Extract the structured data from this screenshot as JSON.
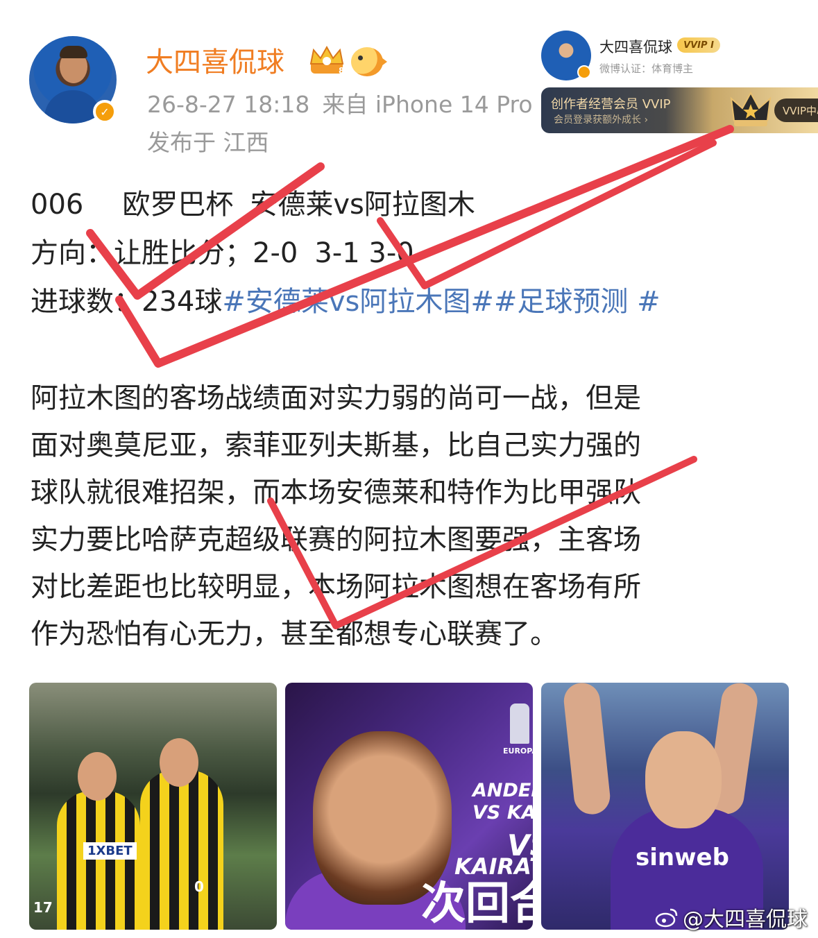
{
  "post": {
    "username": "大四喜侃球",
    "timestamp": "26-8-27 18:18",
    "source": "来自 iPhone 14 Pro",
    "location": "发布于 江西",
    "line1_code": "006",
    "line1_league": "欧罗巴杯",
    "line1_match": "安德莱vs阿拉图木",
    "line2_label": "方向：",
    "line2_value": "让胜比分；2-0",
    "line2_scores": "3-1 3-0",
    "line3_label": "进球数：",
    "line3_value": "234球",
    "line3_tags": "#安德莱vs阿拉木图##足球预测 #",
    "analysis_lines": [
      "阿拉木图的客场战绩面对实力弱的尚可一战，但是",
      "面对奥莫尼亚，索菲亚列夫斯基，比自己实力强的",
      "球队就很难招架，而本场安德莱和特作为比甲强队",
      "实力要比哈萨克超级联赛的阿拉木图要强，主客场",
      "对比差距也比较明显，本场阿拉木图想在客场有所",
      "作为恐怕有心无力，甚至都想专心联赛了。"
    ]
  },
  "profile_card": {
    "name": "大四喜侃球",
    "vip_badge": "VVIP I",
    "auth": "微博认证：体育博主",
    "banner_title": "创作者经营会员 VVIP",
    "banner_sub": "会员登录获额外成长 ›",
    "banner_button": "VVIP中心"
  },
  "images": [
    {
      "name": "kairat-players-celebrating",
      "sponsor": "1XBET",
      "number": "17",
      "number2": "0"
    },
    {
      "name": "anderlecht-vs-kairat-poster",
      "league": "EUROPA LEAGUE",
      "title1": "ANDERL",
      "title2": "VS KAIRAT A",
      "title3": "VS",
      "title4": "KAIRAT A",
      "title5": "次回合"
    },
    {
      "name": "anderlecht-player-applauding",
      "sponsor": "sinweb"
    }
  ],
  "watermark": "@大四喜侃球",
  "colors": {
    "username": "#f07d22",
    "meta": "#9a9a9a",
    "text": "#222222",
    "tag": "#4a76b8",
    "check_marks": "#e8404a"
  },
  "icons": [
    "crown-badge-icon",
    "fish-badge-icon",
    "verified-icon",
    "weibo-logo-icon"
  ]
}
